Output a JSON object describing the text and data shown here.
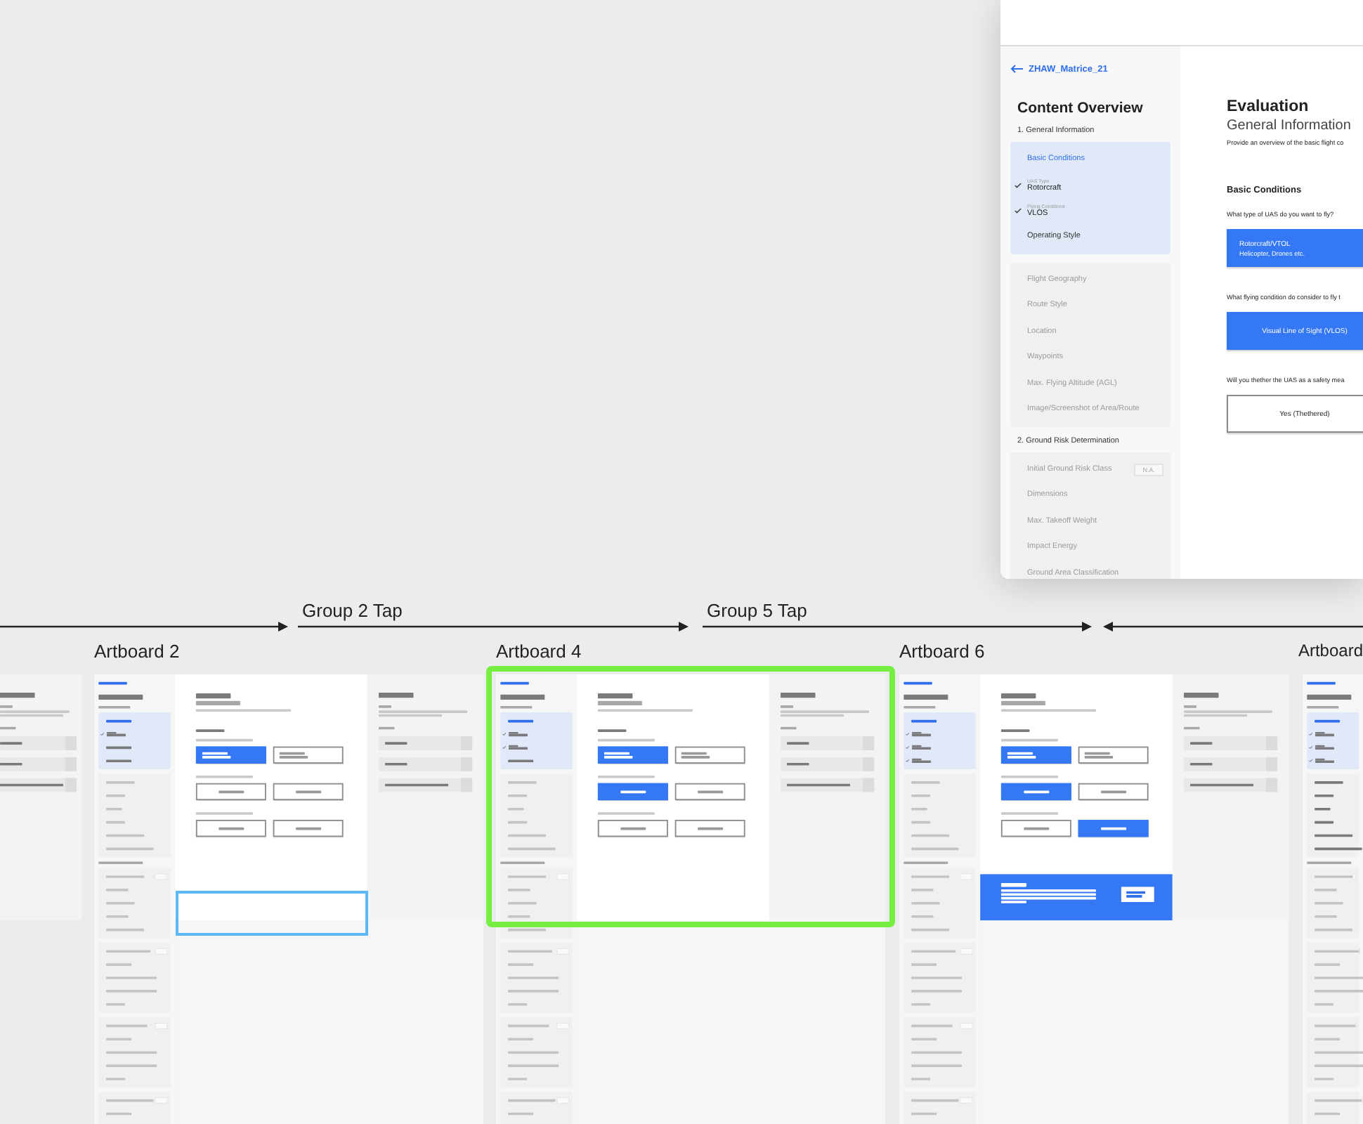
{
  "preview": {
    "sidebar": {
      "back": "ZHAW_Matrice_21",
      "title": "Content Overview",
      "sections": [
        {
          "heading": "1. General Information",
          "groups": [
            {
              "active": true,
              "enabled": true,
              "items": [
                {
                  "kind": "heading",
                  "text": "Basic Conditions"
                },
                {
                  "kind": "answer",
                  "label": "UAS Type",
                  "value": "Rotorcraft"
                },
                {
                  "kind": "answer",
                  "label": "Flying Conditions",
                  "value": "VLOS"
                },
                {
                  "kind": "item",
                  "text": "Operating Style"
                }
              ]
            },
            {
              "active": false,
              "enabled": false,
              "items": [
                {
                  "kind": "item",
                  "text": "Flight Geography"
                },
                {
                  "kind": "item",
                  "text": "Route Style"
                },
                {
                  "kind": "item",
                  "text": "Location"
                },
                {
                  "kind": "item",
                  "text": "Waypoints"
                },
                {
                  "kind": "item",
                  "text": "Max. Flying Altitude (AGL)"
                },
                {
                  "kind": "item",
                  "text": "Image/Screenshot of Area/Route"
                }
              ]
            }
          ]
        },
        {
          "heading": "2. Ground Risk Determination",
          "groups": [
            {
              "active": false,
              "enabled": false,
              "items": [
                {
                  "kind": "item",
                  "text": "Initial Ground Risk Class",
                  "badge": "N.A."
                },
                {
                  "kind": "item",
                  "text": "Dimensions"
                },
                {
                  "kind": "item",
                  "text": "Max. Takeoff Weight"
                },
                {
                  "kind": "item",
                  "text": "Impact Energy"
                },
                {
                  "kind": "item",
                  "text": "Ground Area Classification"
                }
              ]
            }
          ]
        }
      ]
    },
    "main": {
      "title": "Evaluation",
      "subtitle": "General Information",
      "description": "Provide an overview of the basic flight co",
      "section": "Basic Conditions",
      "questions": [
        {
          "text": "What type of UAS do you want to fly?",
          "options": [
            {
              "title": "Rotorcraft/VTOL",
              "subtitle": "Helicopter, Drones etc.",
              "selected": true
            }
          ]
        },
        {
          "text": "What flying condition do consider to fly t",
          "options": [
            {
              "title": "Visual Line of Sight (VLOS)",
              "selected": true
            }
          ]
        },
        {
          "text": "Will you thether the UAS as a safety mea",
          "options": [
            {
              "title": "Yes (Thethered)",
              "selected": false
            }
          ]
        }
      ]
    }
  },
  "connections": [
    {
      "kind": "arrow"
    },
    {
      "kind": "arrow",
      "label": "Group 2 Tap"
    },
    {
      "kind": "arrow",
      "label": "Group 5 Tap"
    },
    {
      "kind": "arrow"
    }
  ],
  "artboards": [
    {
      "kind": "assistance_only"
    },
    {
      "kind": "full",
      "name": "Artboard 2",
      "selected": false,
      "hover_outline": true,
      "basic_rows": [
        {
          "kind": "heading"
        },
        {
          "kind": "answer"
        },
        {
          "kind": "item"
        },
        {
          "kind": "item"
        }
      ],
      "geography_enabled": false,
      "questions": [
        {
          "options": [
            {
              "selected": true
            },
            {
              "selected": false
            }
          ]
        },
        {
          "options": [
            {
              "selected": false
            },
            {
              "selected": false
            }
          ]
        },
        {
          "options": [
            {
              "selected": false
            },
            {
              "selected": false
            }
          ]
        }
      ],
      "banner": false
    },
    {
      "kind": "full",
      "name": "Artboard 4",
      "selected": true,
      "hover_outline": false,
      "basic_rows": [
        {
          "kind": "heading"
        },
        {
          "kind": "answer"
        },
        {
          "kind": "answer"
        },
        {
          "kind": "item"
        }
      ],
      "geography_enabled": false,
      "questions": [
        {
          "options": [
            {
              "selected": true
            },
            {
              "selected": false
            }
          ]
        },
        {
          "options": [
            {
              "selected": true
            },
            {
              "selected": false
            }
          ]
        },
        {
          "options": [
            {
              "selected": false
            },
            {
              "selected": false
            }
          ]
        }
      ],
      "banner": false
    },
    {
      "kind": "full",
      "name": "Artboard 6",
      "selected": false,
      "hover_outline": false,
      "basic_rows": [
        {
          "kind": "heading"
        },
        {
          "kind": "answer"
        },
        {
          "kind": "answer"
        },
        {
          "kind": "answer"
        }
      ],
      "geography_enabled": false,
      "questions": [
        {
          "options": [
            {
              "selected": true
            },
            {
              "selected": false
            }
          ]
        },
        {
          "options": [
            {
              "selected": true
            },
            {
              "selected": false
            }
          ]
        },
        {
          "options": [
            {
              "selected": false
            },
            {
              "selected": true
            }
          ]
        }
      ],
      "banner": true
    },
    {
      "kind": "sidebar_only",
      "name": "Artboard",
      "basic_rows": [
        {
          "kind": "heading"
        },
        {
          "kind": "answer"
        },
        {
          "kind": "answer"
        },
        {
          "kind": "answer"
        }
      ],
      "geography_enabled": true
    }
  ]
}
